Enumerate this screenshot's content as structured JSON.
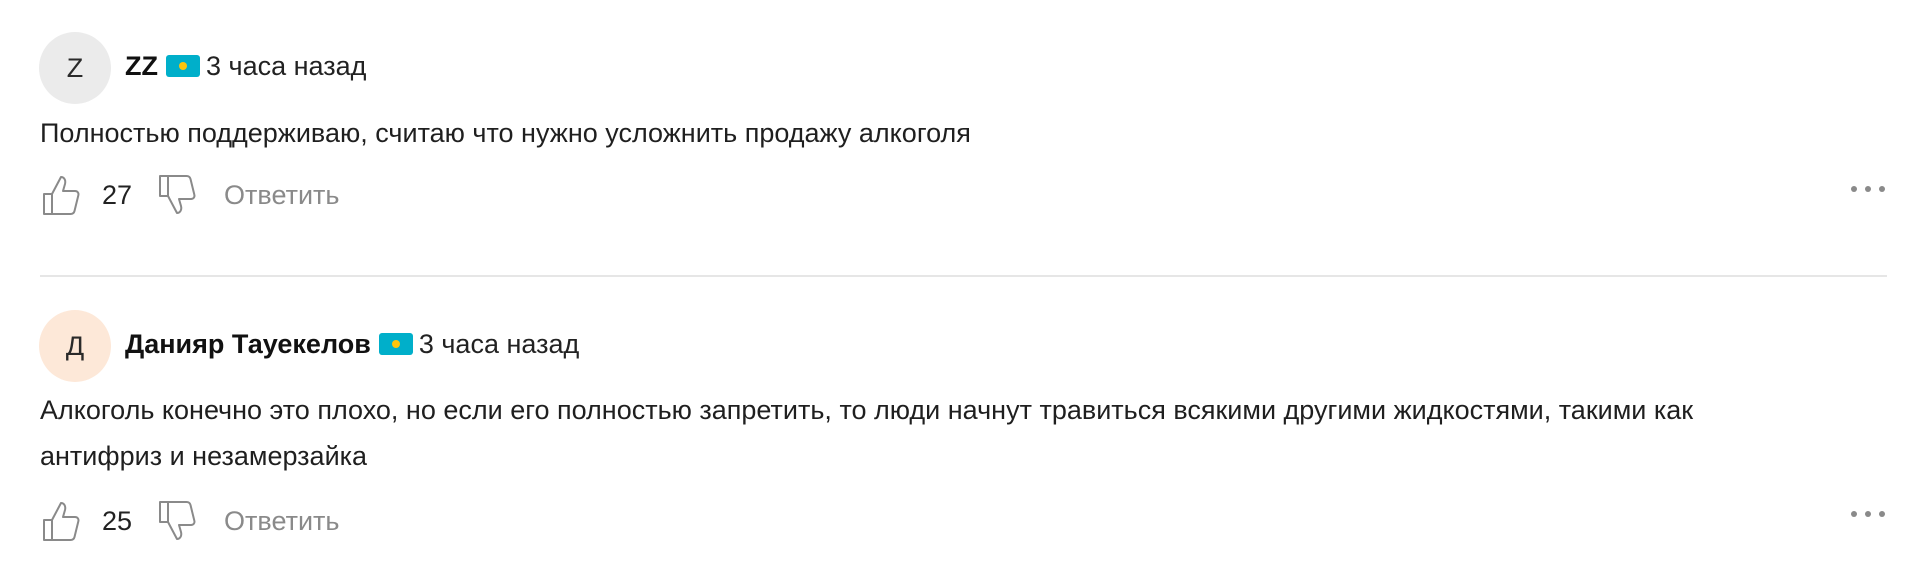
{
  "comments": [
    {
      "avatar_letter": "Z",
      "avatar_color": "#ebebeb",
      "author": "ZZ",
      "flag_icon": "kazakhstan-flag-icon",
      "time": "3 часа назад",
      "text_lines": [
        "Полностью поддерживаю, считаю что нужно усложнить продажу алкоголя"
      ],
      "likes": "27",
      "reply_label": "Ответить"
    },
    {
      "avatar_letter": "Д",
      "avatar_color": "#fde8d8",
      "author": "Данияр Тауекелов",
      "flag_icon": "kazakhstan-flag-icon",
      "time": "3 часа назад",
      "text_lines": [
        "Алкоголь конечно это плохо, но если его полностью запретить, то люди начнут травиться всякими другими жидкостями, такими как",
        "антифриз и незамерзайка"
      ],
      "likes": "25",
      "reply_label": "Ответить"
    }
  ],
  "colors": {
    "flag_blue": "#00afca",
    "flag_sun": "#fec50c",
    "muted_text": "#8a8a8a",
    "divider": "#e6e6e6"
  }
}
